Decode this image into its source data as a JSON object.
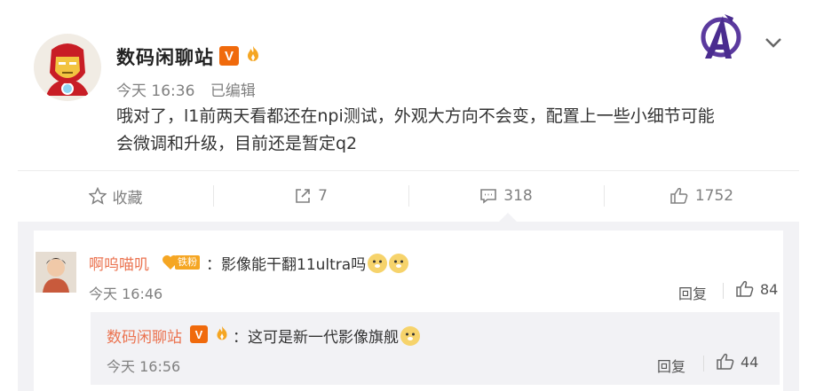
{
  "post": {
    "username": "数码闲聊站",
    "verified_badge": "V",
    "time": "今天 16:36",
    "edited": "已编辑",
    "text_line1": "哦对了，l1前两天看都还在npi测试，外观大方向不会变，配置上一些小细节可能",
    "text_line2": "会微调和升级，目前还是暂定q2",
    "icons": [
      "iron-man-avatar",
      "avengers-logo-icon",
      "chevron-down-icon"
    ]
  },
  "actions": {
    "favorite_label": "收藏",
    "repost_count": "7",
    "comment_count": "318",
    "like_count": "1752"
  },
  "comments": [
    {
      "username": "啊呜喵叽",
      "fan_badge": "铁粉",
      "separator": "：",
      "text": "影像能干翻11ultra吗",
      "emojis": [
        "doge",
        "doge"
      ],
      "time": "今天 16:46",
      "reply_label": "回复",
      "likes": "84",
      "reply": {
        "username": "数码闲聊站",
        "verified_badge": "V",
        "separator": "：",
        "text": "这可是新一代影像旗舰",
        "emojis": [
          "doge"
        ],
        "time": "今天 16:56",
        "reply_label": "回复",
        "likes": "44"
      }
    }
  ],
  "colors": {
    "accent_orange": "#f06a0c",
    "commenter_name": "#eb7350",
    "secondary_text": "#808080",
    "comment_bg": "#f2f2f5"
  }
}
